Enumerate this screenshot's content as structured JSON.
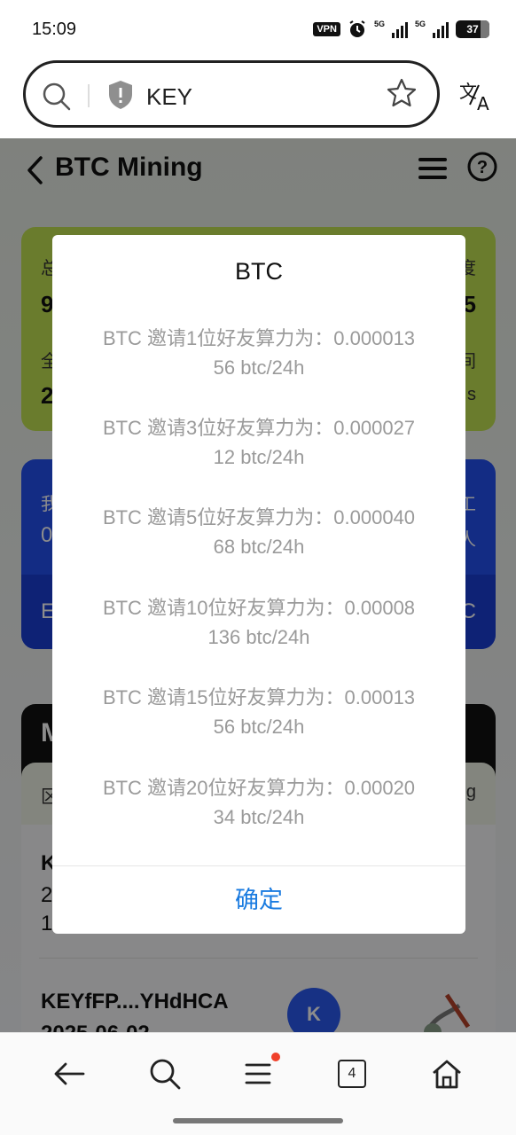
{
  "status_bar": {
    "time": "15:09",
    "vpn_label": "VPN",
    "net1": "5G",
    "net2": "5G",
    "battery": "37"
  },
  "browser": {
    "address_text": "KEY",
    "icons": [
      "search-icon",
      "shield-icon",
      "star-icon",
      "translate-icon"
    ]
  },
  "page": {
    "title": "BTC Mining",
    "card_green": {
      "tl_title": "总",
      "tl_value": "9",
      "tr_title": "度",
      "tr_value": "5",
      "bl_title": "全",
      "bl_value": "2",
      "br_title": "间",
      "br_value": "s"
    },
    "card_blue": {
      "tl_title": "我",
      "tl_value": "0",
      "tr_title": "工",
      "tr_value": "人",
      "bl_title": "E",
      "br_title": "C"
    },
    "card_black": {
      "heading": "M"
    },
    "list_header": {
      "left": "区",
      "right": "g"
    },
    "list": {
      "row1_title": "K",
      "row1_line2": "2",
      "row1_line3": "1",
      "row2_title": "KEYfFP....YHdHCA",
      "row2_date": "2025-06-02",
      "badge": "K"
    }
  },
  "dialog": {
    "title": "BTC",
    "items": [
      {
        "line1": "BTC 邀请1位好友算力为：0.000013",
        "line2": "56 btc/24h"
      },
      {
        "line1": "BTC 邀请3位好友算力为：0.000027",
        "line2": "12 btc/24h"
      },
      {
        "line1": "BTC 邀请5位好友算力为：0.000040",
        "line2": "68 btc/24h"
      },
      {
        "line1": "BTC 邀请10位好友算力为：0.00008",
        "line2": "136 btc/24h"
      },
      {
        "line1": "BTC 邀请15位好友算力为：0.00013",
        "line2": "56 btc/24h"
      },
      {
        "line1": "BTC 邀请20位好友算力为：0.00020",
        "line2": "34 btc/24h"
      }
    ],
    "confirm_label": "确定"
  },
  "bottom_nav": {
    "tab_count": "4",
    "icons": [
      "back-arrow-icon",
      "search-icon",
      "menu-icon",
      "tabs-icon",
      "home-icon"
    ]
  },
  "colors": {
    "accent_blue": "#1a7be0",
    "card_green": "#c1e253",
    "card_blue": "#2450f0",
    "notification_dot": "#f0402a"
  }
}
